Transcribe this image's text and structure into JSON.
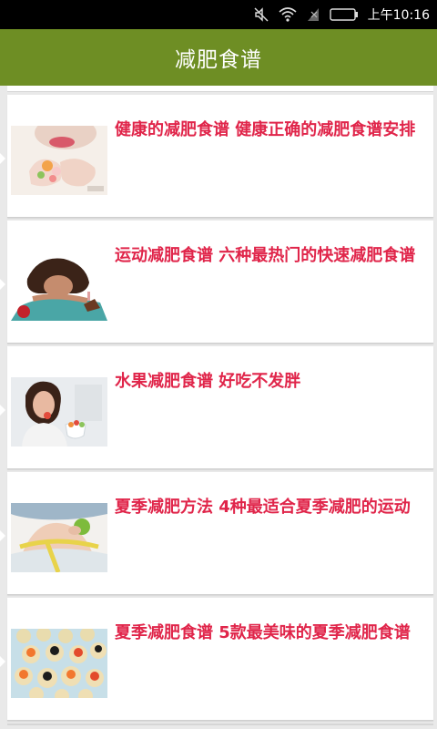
{
  "status_bar": {
    "time": "上午10:16",
    "icons": [
      "mute-icon",
      "wifi-icon",
      "no-signal-icon",
      "battery-icon"
    ]
  },
  "app_bar": {
    "title": "减肥食谱"
  },
  "articles": [
    {
      "title": "健康的减肥食谱 健康正确的减肥食谱安排",
      "thumb": "woman-eating-fruit-image"
    },
    {
      "title": "运动减肥食谱 六种最热门的快速减肥食谱",
      "thumb": "woman-with-cake-image"
    },
    {
      "title": "水果减肥食谱 好吃不发胖",
      "thumb": "woman-eating-fruit-bowl-image"
    },
    {
      "title": "夏季减肥方法 4种最适合夏季减肥的运动",
      "thumb": "waist-measuring-image"
    },
    {
      "title": "夏季减肥食谱 5款最美味的夏季减肥食谱",
      "thumb": "canapes-image"
    }
  ],
  "colors": {
    "app_bar": "#6e8e24",
    "title_text": "#e0254a",
    "background": "#e9e9e9"
  }
}
